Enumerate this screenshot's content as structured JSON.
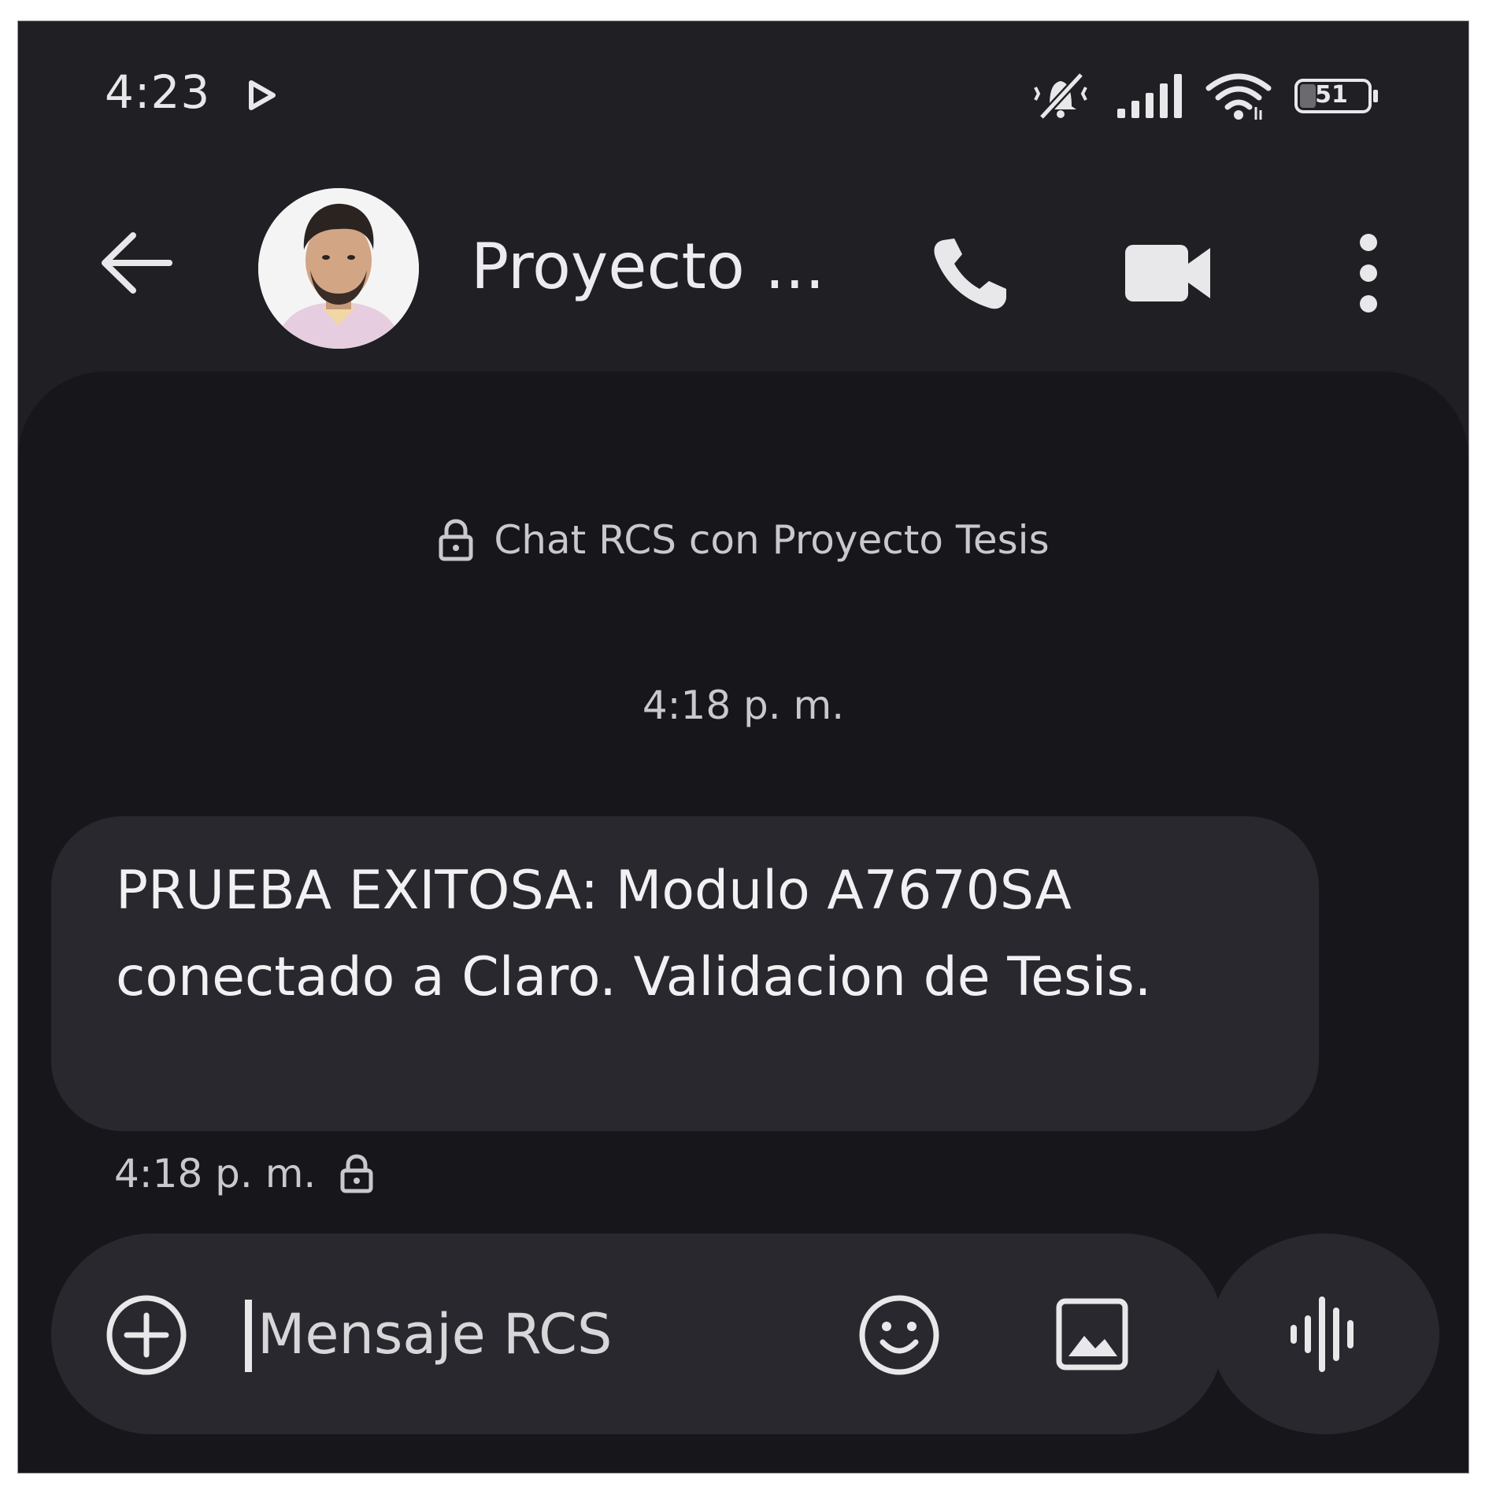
{
  "status_bar": {
    "time": "4:23",
    "battery_level": "51",
    "icons": [
      "play-icon",
      "mute-icon",
      "signal-icon",
      "wifi-icon",
      "battery-icon"
    ]
  },
  "header": {
    "contact_name": "Proyecto ...",
    "icons": [
      "back-arrow-icon",
      "phone-icon",
      "video-camera-icon",
      "more-vert-icon"
    ]
  },
  "chat": {
    "banner": "Chat RCS con Proyecto Tesis",
    "date_separator": "4:18 p. m.",
    "messages": [
      {
        "text": "PRUEBA EXITOSA: Modulo A7670SA conectado a Claro. Validacion de Tesis.",
        "time": "4:18 p. m."
      }
    ]
  },
  "composer": {
    "placeholder": "Mensaje RCS",
    "value": "",
    "icons": [
      "add-circle-icon",
      "emoji-icon",
      "image-icon",
      "voice-icon"
    ]
  },
  "colors": {
    "screen_bg": "#1f1f24",
    "chat_bg": "#17171b",
    "bubble_bg": "#28282e",
    "text": "#f1f1f3",
    "secondary_text": "#c9c9cd"
  }
}
